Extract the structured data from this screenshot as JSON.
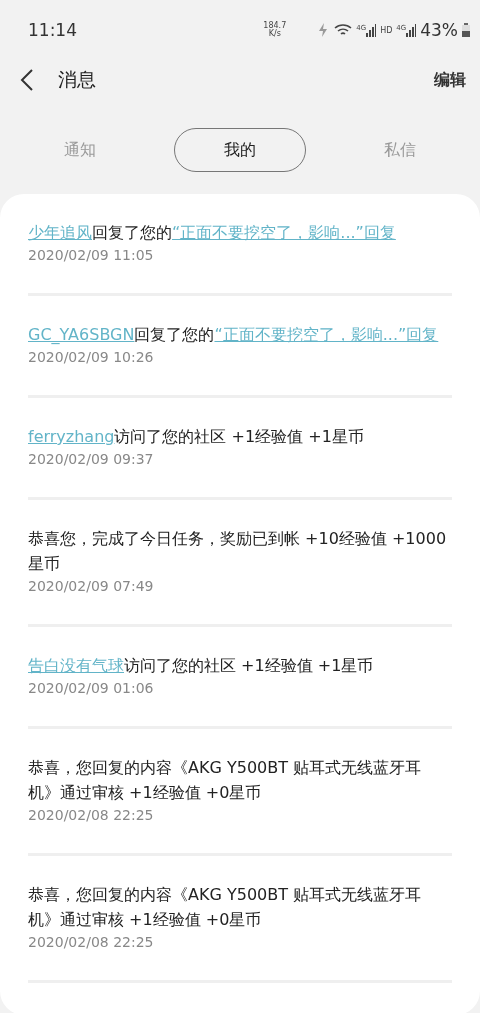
{
  "status_bar": {
    "time": "11:14",
    "speed_value": "184.7",
    "speed_unit": "K/s",
    "network_1": "4G",
    "hd": "HD",
    "network_2": "4G",
    "battery": "43%"
  },
  "header": {
    "title": "消息",
    "action": "编辑"
  },
  "tabs": [
    {
      "label": "通知",
      "selected": false
    },
    {
      "label": "我的",
      "selected": true
    },
    {
      "label": "私信",
      "selected": false
    }
  ],
  "messages": [
    {
      "parts": [
        {
          "kind": "link",
          "text": "少年追风"
        },
        {
          "kind": "text",
          "text": "回复了您的"
        },
        {
          "kind": "link",
          "text": "“正面不要挖空了，影响...”回复"
        }
      ],
      "time": "2020/02/09 11:05"
    },
    {
      "parts": [
        {
          "kind": "link",
          "text": "GC_YA6SBGN"
        },
        {
          "kind": "text",
          "text": "回复了您的"
        },
        {
          "kind": "link",
          "text": "“正面不要挖空了，影响...”回复"
        }
      ],
      "time": "2020/02/09 10:26"
    },
    {
      "parts": [
        {
          "kind": "link",
          "text": "ferryzhang"
        },
        {
          "kind": "text",
          "text": "访问了您的社区 +1经验值 +1星币"
        }
      ],
      "time": "2020/02/09 09:37"
    },
    {
      "parts": [
        {
          "kind": "text",
          "text": "恭喜您，完成了今日任务，奖励已到帐 +10经验值 +1000星币"
        }
      ],
      "time": "2020/02/09 07:49"
    },
    {
      "parts": [
        {
          "kind": "link",
          "text": "告白没有气球"
        },
        {
          "kind": "text",
          "text": "访问了您的社区 +1经验值 +1星币"
        }
      ],
      "time": "2020/02/09 01:06"
    },
    {
      "parts": [
        {
          "kind": "text",
          "text": "恭喜，您回复的内容《AKG Y500BT 贴耳式无线蓝牙耳机》通过审核 +1经验值 +0星币"
        }
      ],
      "time": "2020/02/08 22:25"
    },
    {
      "parts": [
        {
          "kind": "text",
          "text": "恭喜，您回复的内容《AKG Y500BT 贴耳式无线蓝牙耳机》通过审核 +1经验值 +0星币"
        }
      ],
      "time": "2020/02/08 22:25"
    }
  ]
}
